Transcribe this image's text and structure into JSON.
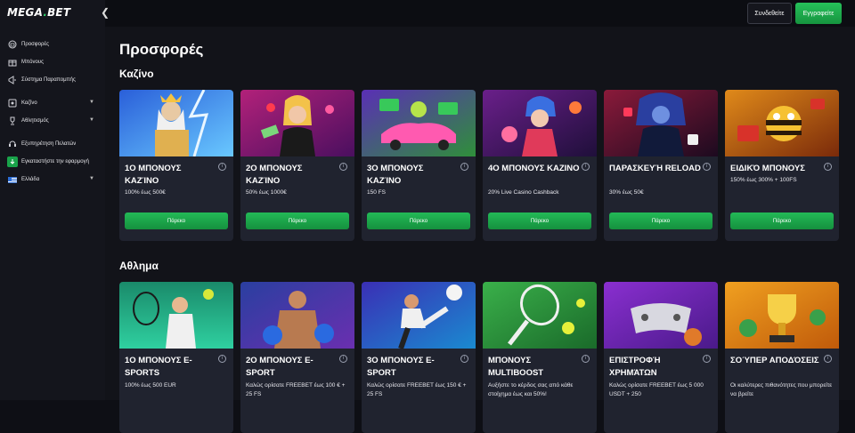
{
  "brand": {
    "name": "MEGA",
    "dot": ".",
    "suffix": "BET"
  },
  "sidebar": {
    "collapse_icon": "chevron-left-icon",
    "items": [
      {
        "label": "Προσφορές",
        "icon": "gift-circle-icon"
      },
      {
        "label": "Μπόνους",
        "icon": "gift-icon"
      },
      {
        "label": "Σύστημα Παραπομπής",
        "icon": "megaphone-icon"
      },
      {
        "label": "Καζίνο",
        "icon": "casino-chip-icon",
        "has_dropdown": true
      },
      {
        "label": "Αθλητισμός",
        "icon": "trophy-icon",
        "has_dropdown": true
      },
      {
        "label": "Εξυπηρέτηση Πελατών",
        "icon": "headset-icon"
      },
      {
        "label": "Εγκαταστήστε την εφαρμογή",
        "icon": "app-download-icon"
      },
      {
        "label": "Ελλάδα",
        "icon": "greece-flag-icon",
        "has_dropdown": true
      }
    ]
  },
  "header": {
    "login_label": "Συνδεθείτε",
    "register_label": "Εγγραφείτε"
  },
  "main": {
    "page_title": "Προσφορές",
    "casino_section": "Καζίνο",
    "sport_section": "Αθλημα"
  },
  "casino_cards": [
    {
      "title": "1Ο ΜΠΟΝΟΥΣ ΚΑΖΊΝΟ",
      "desc": "100% έως 500€",
      "button": "Πάρεκο"
    },
    {
      "title": "2Ο ΜΠΟΝΟΥΣ ΚΑΖΊΝΟ",
      "desc": "50% έως 1000€",
      "button": "Πάρεκο"
    },
    {
      "title": "3Ο ΜΠΟΝΟΥΣ ΚΑΖΊΝΟ",
      "desc": "150 FS",
      "button": "Πάρεκο"
    },
    {
      "title": "4Ο ΜΠΟΝΟΥΣ ΚΑΖΙΝΟ",
      "desc": "20% Live Casino Cashback",
      "button": "Πάρεκο"
    },
    {
      "title": "ΠΑΡΑΣΚΕΥΉ RELOAD",
      "desc": "30% έως 50€",
      "button": "Πάρεκο"
    },
    {
      "title": "ΕΙΔΙΚΌ ΜΠΟΝΟΥΣ",
      "desc": "150% έως 300% + 100FS",
      "button": "Πάρεκο"
    }
  ],
  "sport_cards": [
    {
      "title": "1Ο ΜΠΟΝΟΥΣ E-SPORTS",
      "desc": "100% έως 500 EUR"
    },
    {
      "title": "2Ο ΜΠΟΝΟΥΣ E-SPORT",
      "desc": "Καλώς ορίσατε FREEBET έως 100 € + 25 FS"
    },
    {
      "title": "3Ο ΜΠΟΝΟΥΣ E-SPORT",
      "desc": "Καλώς ορίσατε FREEBET έως 150 € + 25 FS"
    },
    {
      "title": "ΜΠΟΝΟΥΣ MULTIBOOST",
      "desc": "Αυξήστε το κέρδος σας από κάθε στοίχημα έως και 50%!"
    },
    {
      "title": "ΕΠΙΣΤΡΟΦΉ ΧΡΗΜΆΤΩΝ",
      "desc": "Καλώς ορίσατε FREEBET έως 5 000 USDT + 250"
    },
    {
      "title": "ΣΟΎΠΕΡ ΑΠΟΔΌΣΕΙΣ",
      "desc": "Οι καλύτερες πιθανότητες που μπορείτε να βρείτε"
    }
  ],
  "info_icon": "info-icon",
  "colors": {
    "accent_green": "#1fb150",
    "background": "#121319",
    "card": "#20232f"
  }
}
